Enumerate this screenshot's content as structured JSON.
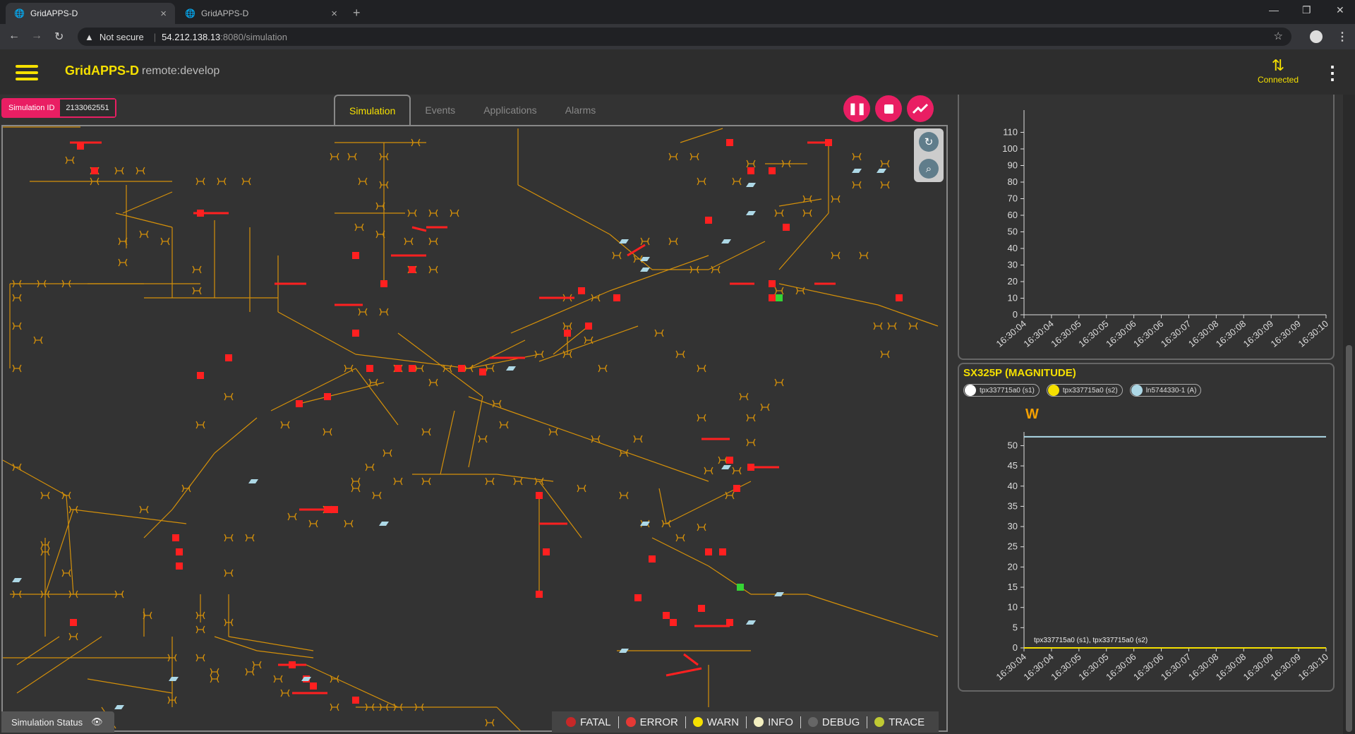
{
  "browser": {
    "tabs": [
      {
        "title": "GridAPPS-D",
        "close": "×"
      },
      {
        "title": "GridAPPS-D",
        "close": "×"
      }
    ],
    "new_tab": "+",
    "security": "Not secure",
    "url_host": "54.212.138.13",
    "url_path": ":8080/simulation"
  },
  "app": {
    "title": "GridAPPS-D",
    "environment": "remote:develop",
    "connection_status": "Connected",
    "connection_icon": "⇅"
  },
  "simulation": {
    "id_label": "Simulation ID",
    "id_value": "2133062551"
  },
  "tabs": [
    {
      "label": "Simulation",
      "active": true
    },
    {
      "label": "Events",
      "active": false
    },
    {
      "label": "Applications",
      "active": false
    },
    {
      "label": "Alarms",
      "active": false
    }
  ],
  "controls": {
    "pause": "pause-icon",
    "stop": "stop-icon",
    "plot": "trend-icon"
  },
  "status_bar": {
    "label": "Simulation Status",
    "levels": [
      {
        "label": "FATAL",
        "color": "#c62828"
      },
      {
        "label": "ERROR",
        "color": "#e53935"
      },
      {
        "label": "WARN",
        "color": "#f5e000"
      },
      {
        "label": "INFO",
        "color": "#f3efc0"
      },
      {
        "label": "DEBUG",
        "color": "#666666"
      },
      {
        "label": "TRACE",
        "color": "#c0ca33"
      }
    ]
  },
  "colors": {
    "accent": "#f5e000",
    "danger": "#e91e63",
    "line": "#d4900a",
    "switch_open": "#ff2020",
    "switch_closed": "#35d435",
    "regulator": "#add8e6"
  },
  "charts": [
    {
      "type": "line",
      "title": "",
      "ylim": [
        0,
        120
      ],
      "yticks": [
        0,
        10,
        20,
        30,
        40,
        50,
        60,
        70,
        80,
        90,
        100,
        110
      ],
      "x": [
        "16:30:04",
        "16:30:04",
        "16:30:05",
        "16:30:05",
        "16:30:06",
        "16:30:06",
        "16:30:07",
        "16:30:08",
        "16:30:08",
        "16:30:09",
        "16:30:09",
        "16:30:10"
      ]
    },
    {
      "type": "line",
      "title": "SX325P (MAGNITUDE)",
      "unit": "W",
      "ylim": [
        0,
        52
      ],
      "yticks": [
        0,
        5,
        10,
        15,
        20,
        25,
        30,
        35,
        40,
        45,
        50
      ],
      "x": [
        "16:30:04",
        "16:30:04",
        "16:30:05",
        "16:30:05",
        "16:30:06",
        "16:30:06",
        "16:30:07",
        "16:30:08",
        "16:30:08",
        "16:30:09",
        "16:30:09",
        "16:30:10"
      ],
      "legend": [
        {
          "name": "tpx337715a0 (s1)",
          "color": "#ffffff"
        },
        {
          "name": "tpx337715a0 (s2)",
          "color": "#f5e000"
        },
        {
          "name": "ln5744330-1 (A)",
          "color": "#add8e6"
        }
      ],
      "series": [
        {
          "name": "ln5744330-1 (A)",
          "color": "#add8e6",
          "values": [
            52.2,
            52.2,
            52.2,
            52.2,
            52.2,
            52.2,
            52.2,
            52.2,
            52.2,
            52.2,
            52.2,
            52.2
          ]
        },
        {
          "name": "tpx337715a0 (s1)",
          "color": "#ffffff",
          "values": [
            0,
            0,
            0,
            0,
            0,
            0,
            0,
            0,
            0,
            0,
            0,
            0
          ]
        },
        {
          "name": "tpx337715a0 (s2)",
          "color": "#f5e000",
          "values": [
            0,
            0,
            0,
            0,
            0,
            0,
            0,
            0,
            0,
            0,
            0,
            0
          ]
        }
      ],
      "annotation": "tpx337715a0 (s1), tpx337715a0 (s2)"
    }
  ]
}
